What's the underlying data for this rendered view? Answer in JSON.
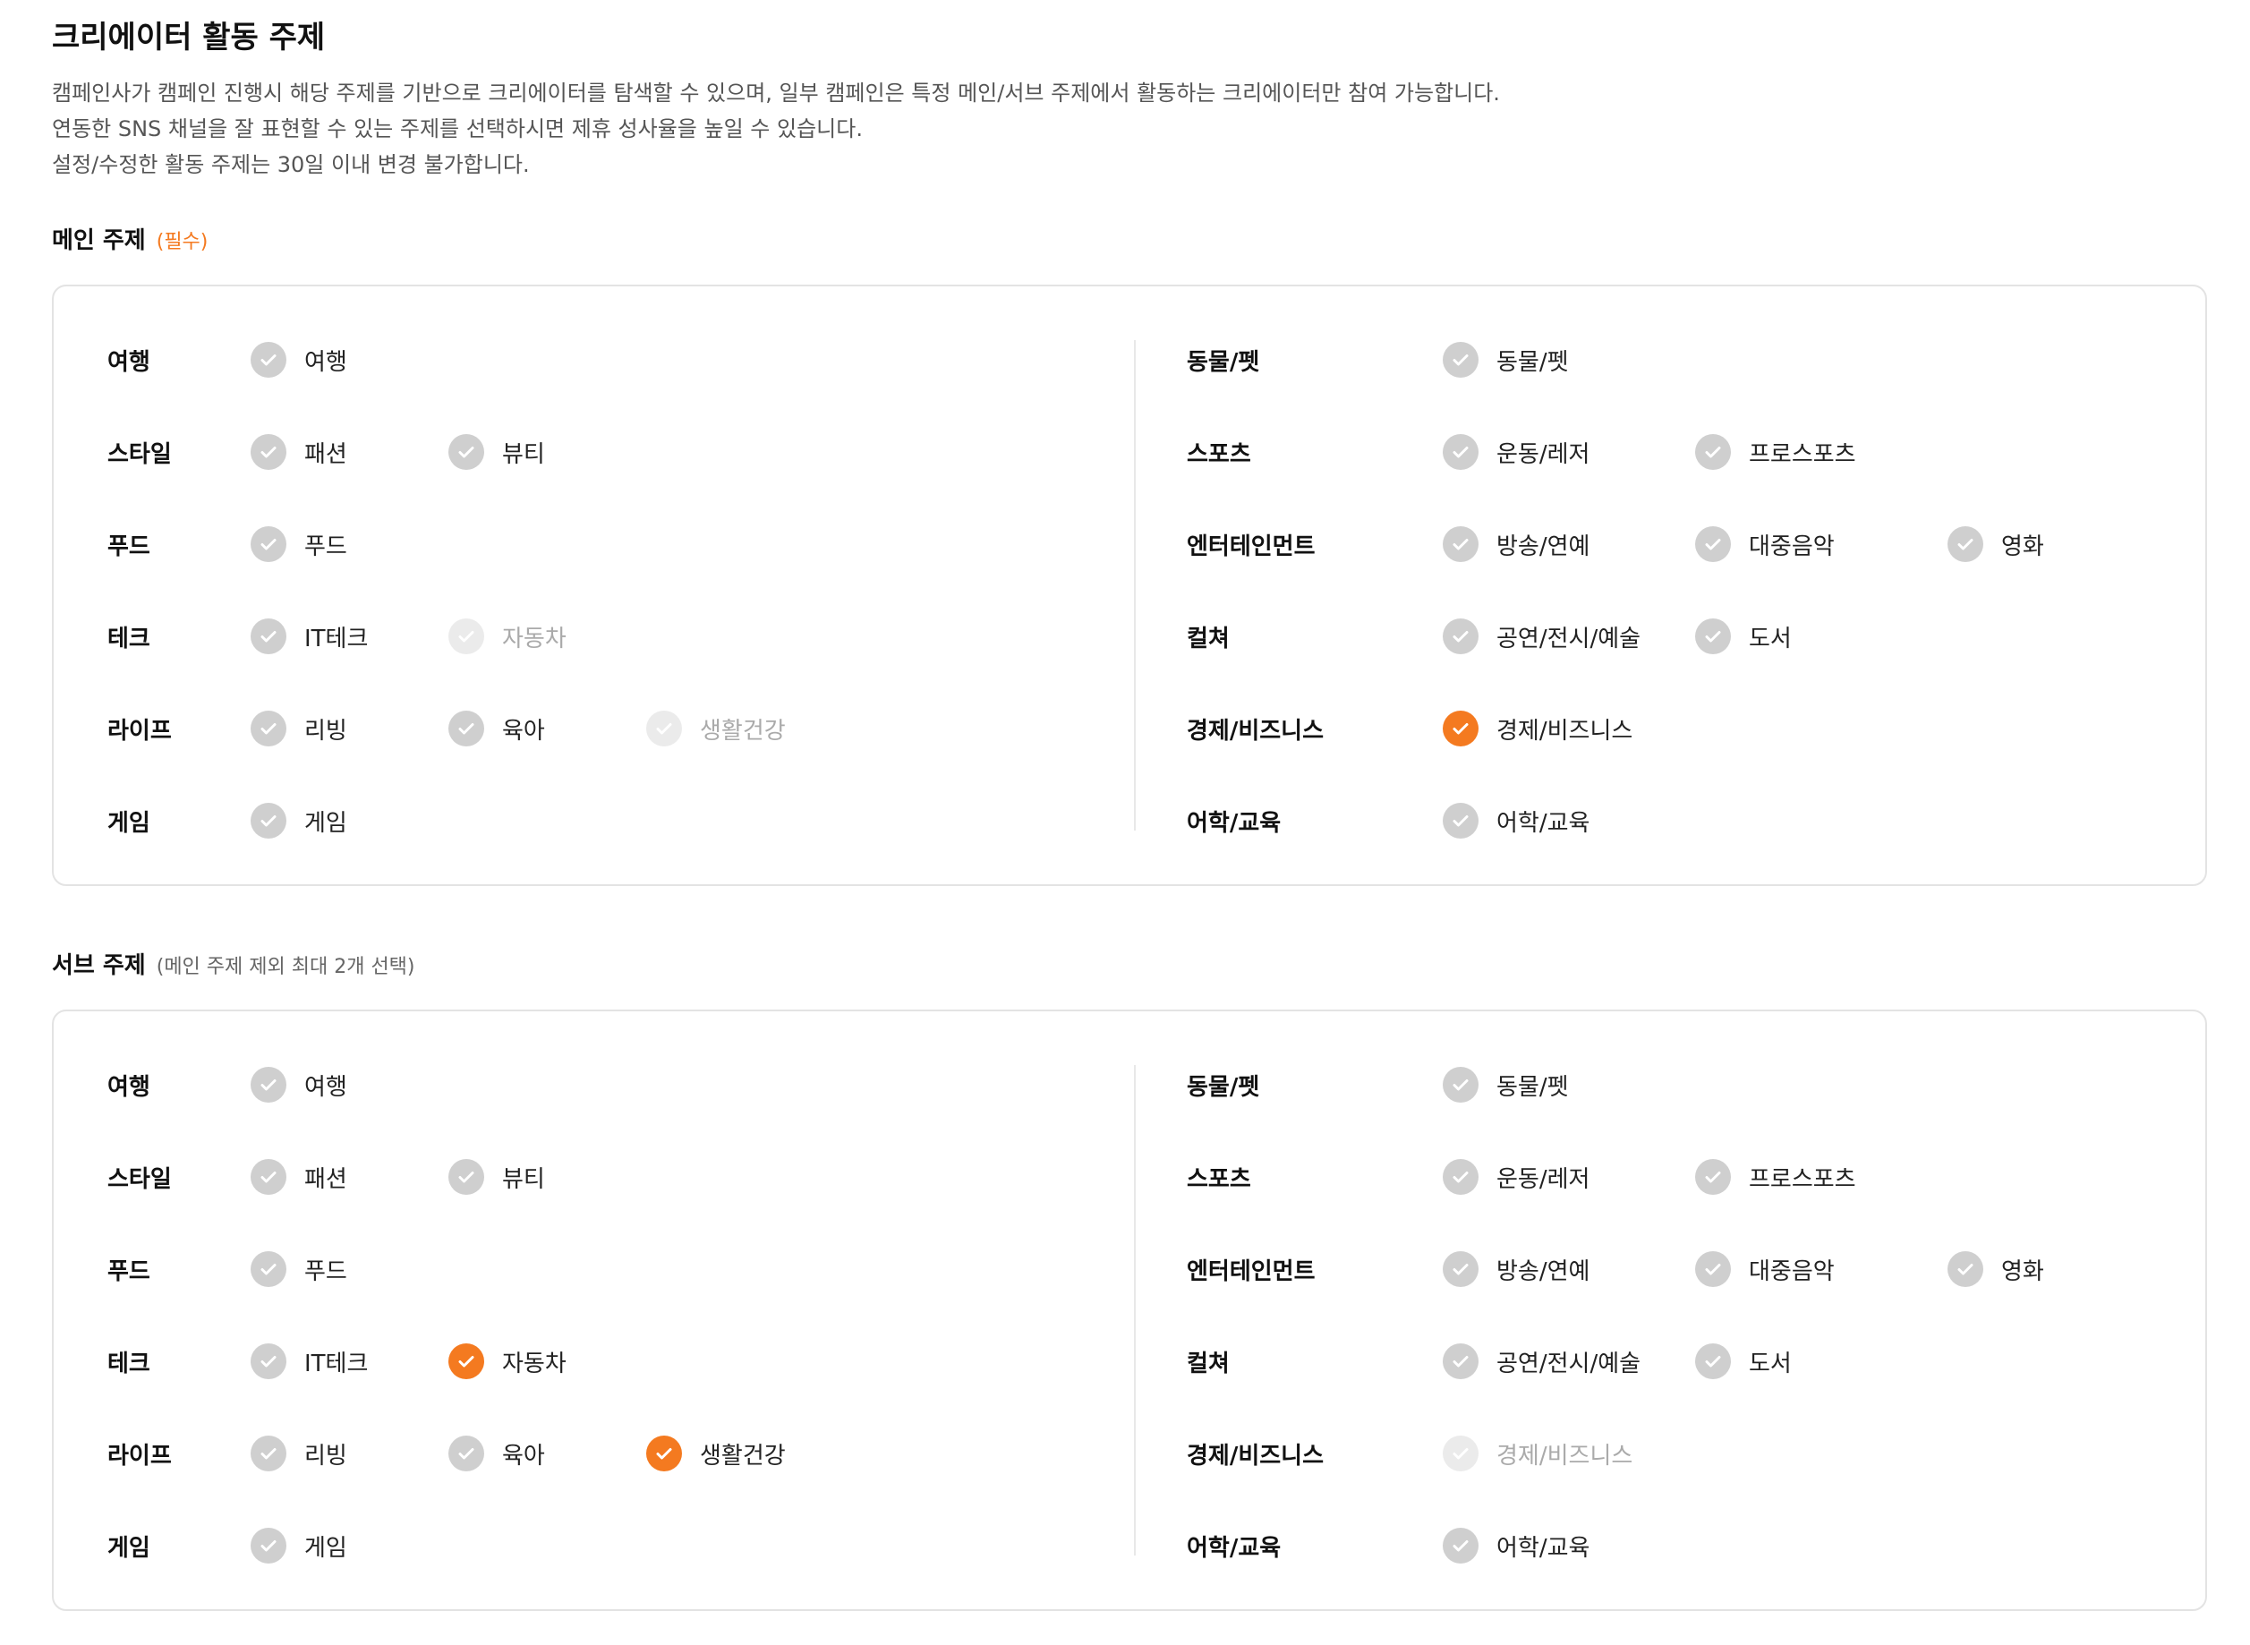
{
  "header": {
    "title": "크리에이터 활동 주제",
    "desc": [
      "캠페인사가 캠페인 진행시 해당 주제를 기반으로 크리에이터를 탐색할 수 있으며, 일부 캠페인은 특정 메인/서브 주제에서 활동하는 크리에이터만 참여 가능합니다.",
      "연동한 SNS 채널을 잘 표현할 수 있는 주제를 선택하시면 제휴 성사율을 높일 수 있습니다.",
      "설정/수정한 활동 주제는 30일 이내 변경 불가합니다."
    ]
  },
  "colors": {
    "accent": "#f47a20",
    "check_default": "#cfcfcf",
    "check_disabled": "#ebebeb"
  },
  "main": {
    "label": "메인 주제",
    "note": "(필수)",
    "left": [
      {
        "category": "여행",
        "options": [
          {
            "label": "여행",
            "state": "default"
          }
        ]
      },
      {
        "category": "스타일",
        "options": [
          {
            "label": "패션",
            "state": "default"
          },
          {
            "label": "뷰티",
            "state": "default"
          }
        ]
      },
      {
        "category": "푸드",
        "options": [
          {
            "label": "푸드",
            "state": "default"
          }
        ]
      },
      {
        "category": "테크",
        "options": [
          {
            "label": "IT테크",
            "state": "default"
          },
          {
            "label": "자동차",
            "state": "disabled"
          }
        ]
      },
      {
        "category": "라이프",
        "options": [
          {
            "label": "리빙",
            "state": "default"
          },
          {
            "label": "육아",
            "state": "default"
          },
          {
            "label": "생활건강",
            "state": "disabled"
          }
        ]
      },
      {
        "category": "게임",
        "options": [
          {
            "label": "게임",
            "state": "default"
          }
        ]
      }
    ],
    "right": [
      {
        "category": "동물/펫",
        "options": [
          {
            "label": "동물/펫",
            "state": "default"
          }
        ]
      },
      {
        "category": "스포츠",
        "options": [
          {
            "label": "운동/레저",
            "state": "default"
          },
          {
            "label": "프로스포츠",
            "state": "default"
          }
        ]
      },
      {
        "category": "엔터테인먼트",
        "options": [
          {
            "label": "방송/연예",
            "state": "default"
          },
          {
            "label": "대중음악",
            "state": "default"
          },
          {
            "label": "영화",
            "state": "default"
          }
        ]
      },
      {
        "category": "컬쳐",
        "options": [
          {
            "label": "공연/전시/예술",
            "state": "default"
          },
          {
            "label": "도서",
            "state": "default"
          }
        ]
      },
      {
        "category": "경제/비즈니스",
        "options": [
          {
            "label": "경제/비즈니스",
            "state": "checked"
          }
        ]
      },
      {
        "category": "어학/교육",
        "options": [
          {
            "label": "어학/교육",
            "state": "default"
          }
        ]
      }
    ]
  },
  "sub": {
    "label": "서브 주제",
    "note": "(메인 주제 제외 최대 2개 선택)",
    "left": [
      {
        "category": "여행",
        "options": [
          {
            "label": "여행",
            "state": "default"
          }
        ]
      },
      {
        "category": "스타일",
        "options": [
          {
            "label": "패션",
            "state": "default"
          },
          {
            "label": "뷰티",
            "state": "default"
          }
        ]
      },
      {
        "category": "푸드",
        "options": [
          {
            "label": "푸드",
            "state": "default"
          }
        ]
      },
      {
        "category": "테크",
        "options": [
          {
            "label": "IT테크",
            "state": "default"
          },
          {
            "label": "자동차",
            "state": "checked"
          }
        ]
      },
      {
        "category": "라이프",
        "options": [
          {
            "label": "리빙",
            "state": "default"
          },
          {
            "label": "육아",
            "state": "default"
          },
          {
            "label": "생활건강",
            "state": "checked"
          }
        ]
      },
      {
        "category": "게임",
        "options": [
          {
            "label": "게임",
            "state": "default"
          }
        ]
      }
    ],
    "right": [
      {
        "category": "동물/펫",
        "options": [
          {
            "label": "동물/펫",
            "state": "default"
          }
        ]
      },
      {
        "category": "스포츠",
        "options": [
          {
            "label": "운동/레저",
            "state": "default"
          },
          {
            "label": "프로스포츠",
            "state": "default"
          }
        ]
      },
      {
        "category": "엔터테인먼트",
        "options": [
          {
            "label": "방송/연예",
            "state": "default"
          },
          {
            "label": "대중음악",
            "state": "default"
          },
          {
            "label": "영화",
            "state": "default"
          }
        ]
      },
      {
        "category": "컬쳐",
        "options": [
          {
            "label": "공연/전시/예술",
            "state": "default"
          },
          {
            "label": "도서",
            "state": "default"
          }
        ]
      },
      {
        "category": "경제/비즈니스",
        "options": [
          {
            "label": "경제/비즈니스",
            "state": "disabled"
          }
        ]
      },
      {
        "category": "어학/교육",
        "options": [
          {
            "label": "어학/교육",
            "state": "default"
          }
        ]
      }
    ]
  }
}
